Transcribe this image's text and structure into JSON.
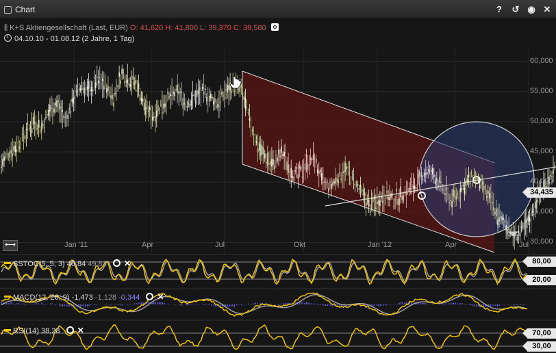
{
  "window": {
    "title": "Chart"
  },
  "header": {
    "instrument": "K+S Aktiengesellschaft (Last, EUR)",
    "ohlc": "O: 41,620  H: 41,800  L: 39,370  C: 39,580",
    "range": "04.10.10 - 01.08.12 (2 Jahre, 1 Tag)"
  },
  "price_tag": "34,435",
  "x_labels": [
    "Jan '11",
    "Apr",
    "Jul",
    "Okt",
    "Jan '12",
    "Apr",
    "Jul"
  ],
  "y_labels": [
    "60,000",
    "55,000",
    "50,000",
    "45,000",
    "40,000",
    "35,000",
    "30,000"
  ],
  "indicators": {
    "stoch": {
      "name": "SSTOC(5, 5, 3)",
      "v1": "46,84",
      "v2": "49,83",
      "upper": "80,00",
      "lower": "20,00"
    },
    "macd": {
      "name": "MACD(12, 26, 9)",
      "v1": "-1,473",
      "v2": "-1,128",
      "v3": "-0,344"
    },
    "rsi": {
      "name": "RSI(14)",
      "v1": "38,28",
      "upper": "70,00",
      "lower": "30,00"
    }
  },
  "colors": {
    "up": "#f0f0d8",
    "channel": "#5a1414",
    "ellipse": "#2a3a6a",
    "indicator": "#f2c200",
    "signal": "#a0a0a0",
    "macd_hist": "#6a6af0"
  },
  "chart_data": {
    "type": "line",
    "series": [
      {
        "values": [
          43,
          45,
          46,
          48,
          50,
          49,
          52,
          53,
          50,
          54,
          56,
          55,
          57,
          56,
          54,
          58,
          57,
          56,
          52,
          51,
          53,
          54,
          55,
          53,
          54,
          55,
          54,
          53,
          55,
          56,
          55,
          50,
          46,
          44,
          43,
          45,
          42,
          41,
          43,
          44,
          40,
          39,
          41,
          42,
          40,
          38,
          36,
          37,
          38,
          37,
          38,
          39,
          40,
          42,
          41,
          39,
          37,
          38,
          40,
          41,
          39,
          37,
          34,
          33,
          31,
          32,
          34,
          38,
          40,
          42
        ]
      }
    ],
    "ylim": [
      28,
      62
    ],
    "yticks": [
      60,
      55,
      50,
      45,
      40,
      35,
      30
    ]
  }
}
